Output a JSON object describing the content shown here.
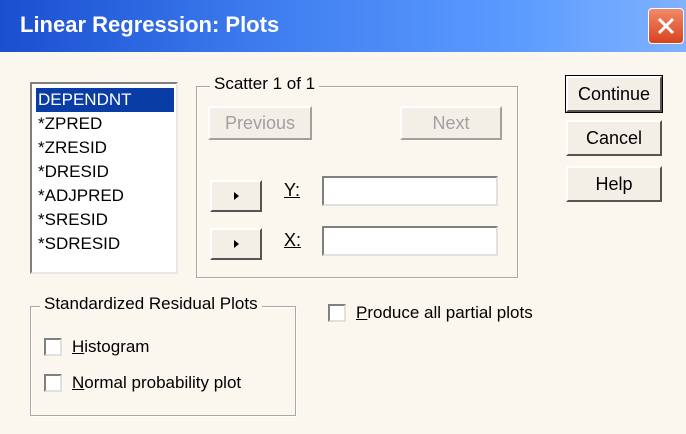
{
  "window": {
    "title": "Linear Regression: Plots"
  },
  "variables": [
    "DEPENDNT",
    "*ZPRED",
    "*ZRESID",
    "*DRESID",
    "*ADJPRED",
    "*SRESID",
    "*SDRESID"
  ],
  "selected_variable": "DEPENDNT",
  "scatter": {
    "group_label": "Scatter 1 of 1",
    "previous_label": "Previous",
    "next_label": "Next",
    "y_label": "Y:",
    "x_label": "X:",
    "y_value": "",
    "x_value": "",
    "move_icon": "right-arrow-icon"
  },
  "buttons": {
    "continue": "Continue",
    "cancel": "Cancel",
    "help": "Help"
  },
  "residual_plots": {
    "group_label": "Standardized Residual Plots",
    "histogram": {
      "label_first": "H",
      "label_rest": "istogram",
      "checked": false
    },
    "normal_prob": {
      "label_first": "N",
      "label_rest": "ormal probability plot",
      "checked": false
    }
  },
  "partial_plots": {
    "label_first": "P",
    "label_rest": "roduce all partial plots",
    "checked": false
  },
  "colors": {
    "title_bar": "#1a4fd0",
    "selection": "#0a3ca6",
    "close_button": "#d8431d"
  }
}
